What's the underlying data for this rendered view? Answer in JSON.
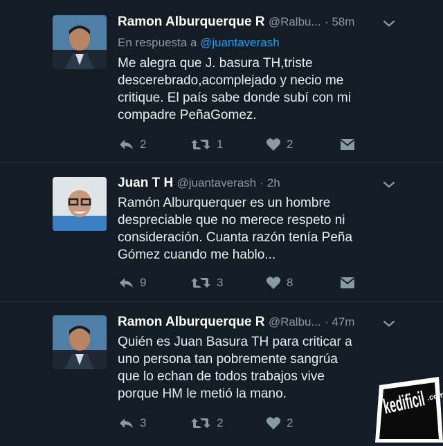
{
  "tweets": [
    {
      "name": "Ramon Alburquerque R",
      "handle": "@Ralbu...",
      "time": "· 58m",
      "reply_label": "En respuesta a",
      "reply_mention": "@juantaverash",
      "lines": [
        "Me alegra que J. basura TH,triste",
        "descerebrado,acomplejado y necio me",
        "critique. El país sabe donde subí con  mi",
        "compadre PeñaGomez."
      ],
      "replies": "2",
      "retweets": "1",
      "likes": "2"
    },
    {
      "name": "Juan T H",
      "handle": "@juantaverash",
      "time": "· 2h",
      "lines": [
        "Ramón Alburquerquer es un hombre",
        "despreciable que no merece respeto ni",
        "consideración. Cuanta razón tenía Peña",
        "Gómez cuando me hablo..."
      ],
      "replies": "9",
      "retweets": "3",
      "likes": "8"
    },
    {
      "name": "Ramon Alburquerque R",
      "handle": "@Ralbu...",
      "time": "· 47m",
      "lines": [
        "Quién es Juan Basura TH para criticar a",
        "uno persona tan pobremente sangrúa",
        "que lo echan de todos trabajos vive",
        "porque HM le metió la mano."
      ],
      "replies": "3",
      "retweets": "2",
      "likes": "2"
    }
  ],
  "watermark": {
    "text": "kedificil",
    "suffix": ".com"
  },
  "colors": {
    "background": "#141d26",
    "divider": "#243447",
    "muted": "#8899a6",
    "mention": "#1da1f2"
  },
  "icons": [
    "reply-icon",
    "retweet-icon",
    "heart-icon",
    "direct-message-icon",
    "chevron-down-icon"
  ]
}
